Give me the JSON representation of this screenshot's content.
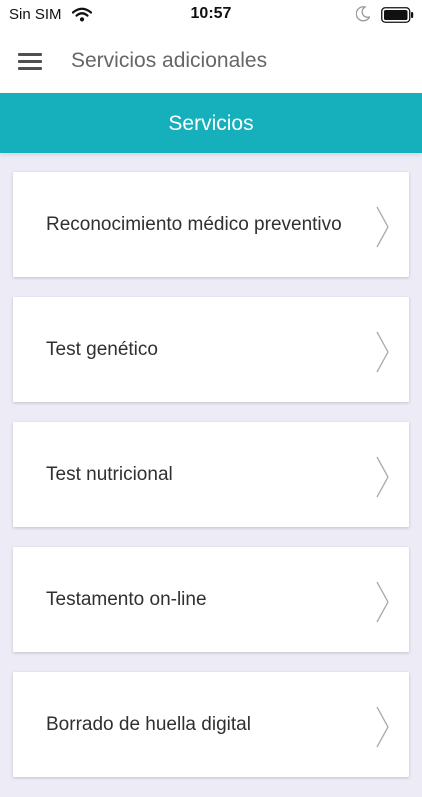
{
  "status_bar": {
    "carrier": "Sin SIM",
    "time": "10:57",
    "icons": [
      "wifi-icon",
      "moon-icon",
      "battery-icon"
    ]
  },
  "navbar": {
    "menu_icon": "hamburger-menu-icon",
    "title": "Servicios adicionales"
  },
  "section_header": {
    "title": "Servicios"
  },
  "services": [
    {
      "label": "Reconocimiento médico preventivo"
    },
    {
      "label": "Test genético"
    },
    {
      "label": "Test nutricional"
    },
    {
      "label": "Testamento on-line"
    },
    {
      "label": "Borrado de huella digital"
    }
  ],
  "colors": {
    "accent": "#16b0bc",
    "background": "#ecebf6",
    "card": "#ffffff",
    "text": "#303030",
    "chevron": "#aaaaaa"
  }
}
